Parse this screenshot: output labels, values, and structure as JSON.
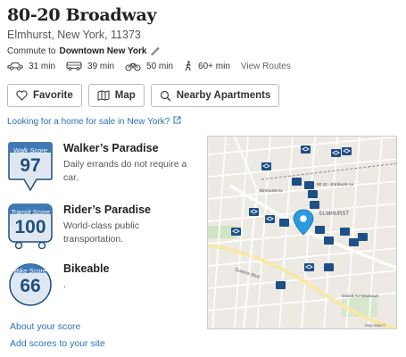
{
  "address": {
    "title": "80-20 Broadway",
    "subtitle": "Elmhurst, New York, 11373"
  },
  "commute": {
    "prefix": "Commute to",
    "destination": "Downtown New York",
    "modes": [
      {
        "icon": "car-icon",
        "time": "31 min"
      },
      {
        "icon": "bus-icon",
        "time": "39 min"
      },
      {
        "icon": "bike-icon",
        "time": "50 min"
      },
      {
        "icon": "walk-icon",
        "time": "60+ min"
      }
    ],
    "view_routes": "View Routes"
  },
  "buttons": {
    "favorite": "Favorite",
    "map": "Map",
    "nearby": "Nearby Apartments"
  },
  "for_sale_link": "Looking for a home for sale in New York?",
  "scores": {
    "walk": {
      "badge_label": "Walk Score",
      "value": "97",
      "title": "Walker’s Paradise",
      "desc": "Daily errands do not require a car."
    },
    "transit": {
      "badge_label": "Transit Score",
      "value": "100",
      "title": "Rider’s Paradise",
      "desc": "World-class public transportation."
    },
    "bike": {
      "badge_label": "Bike Score",
      "value": "66",
      "title": "Bikeable",
      "desc": "."
    }
  },
  "links": {
    "about": "About your score",
    "add": "Add scores to your site"
  },
  "map": {
    "labels": {
      "elmhurst": "ELMHURST",
      "station": "90 St - Elmhurst Av",
      "elmhurst_av": "Elmhurst Av",
      "grand_av": "Grand Av-Newtown",
      "queens_blvd": "Queens Blvd",
      "credit": "Map data ©"
    }
  },
  "colors": {
    "link": "#2a72b8",
    "badge_blue": "#1f4f80",
    "pin_blue": "#2b9be0"
  }
}
